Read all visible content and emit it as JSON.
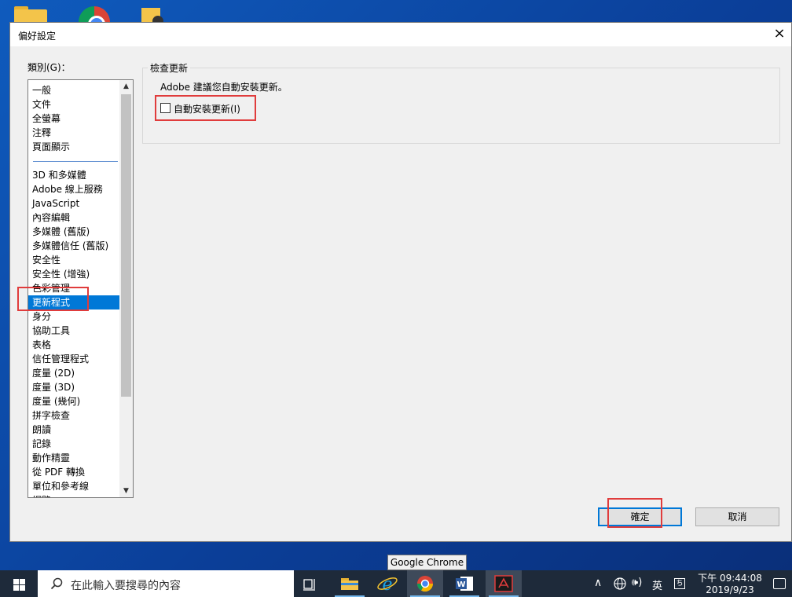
{
  "window": {
    "title": "偏好設定",
    "close": "×"
  },
  "categories": {
    "label": "類別(G)：",
    "group1": [
      "一般",
      "文件",
      "全螢幕",
      "注釋",
      "頁面顯示"
    ],
    "group2": [
      "3D 和多媒體",
      "Adobe 線上服務",
      "JavaScript",
      "內容編輯",
      "多媒體 (舊版)",
      "多媒體信任 (舊版)",
      "安全性",
      "安全性 (增強)",
      "色彩管理",
      "更新程式",
      "身分",
      "協助工具",
      "表格",
      "信任管理程式",
      "度量 (2D)",
      "度量 (3D)",
      "度量 (幾何)",
      "拼字檢查",
      "朗讀",
      "記錄",
      "動作精靈",
      "從 PDF 轉換",
      "單位和參考線",
      "網路"
    ],
    "selected": "更新程式"
  },
  "update_panel": {
    "group_title": "檢查更新",
    "description": "Adobe 建議您自動安裝更新。",
    "auto_install_label": "自動安裝更新(I)",
    "auto_install_checked": false
  },
  "buttons": {
    "ok": "確定",
    "cancel": "取消"
  },
  "tooltip": "Google Chrome",
  "taskbar": {
    "search_placeholder": "在此輸入要搜尋的內容",
    "apps": [
      "task-view",
      "file-explorer",
      "internet-explorer",
      "google-chrome",
      "microsoft-word",
      "adobe-acrobat"
    ],
    "tray": {
      "chevron": "∧",
      "volume": "🕪)",
      "language": "英",
      "ime": "ち"
    },
    "clock_time": "下午 09:44:08",
    "clock_date": "2019/9/23"
  },
  "colors": {
    "selection": "#0078d7",
    "highlight": "#e03c3c"
  }
}
